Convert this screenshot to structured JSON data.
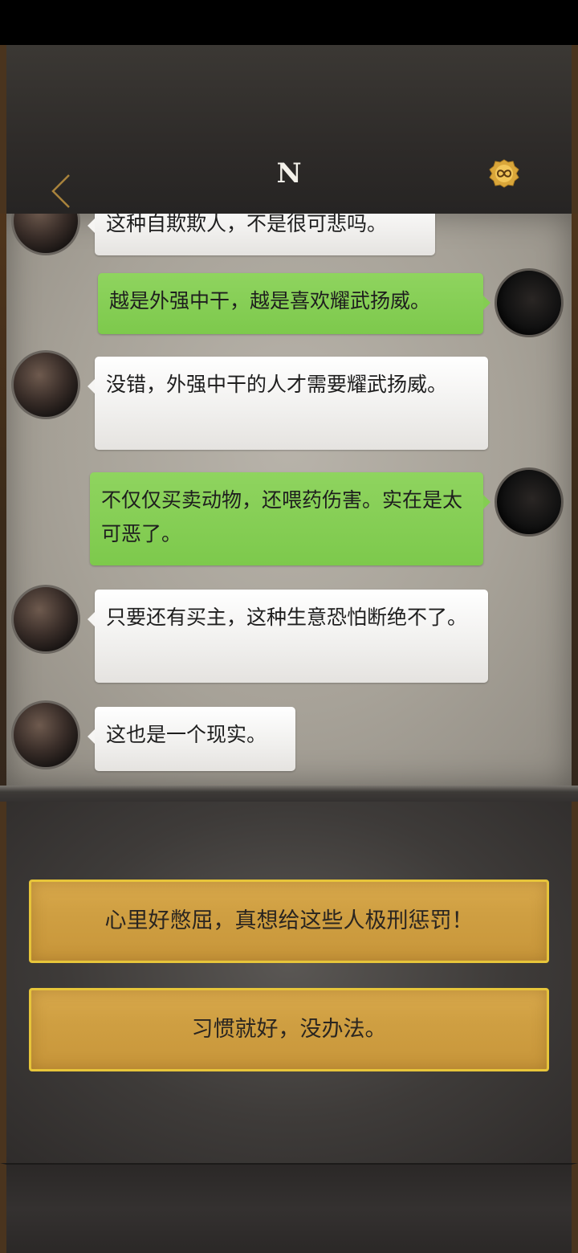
{
  "header": {
    "title": "N",
    "back_icon": "chevron-left-icon",
    "coin_icon": "infinity-coin-icon"
  },
  "messages": [
    {
      "side": "left",
      "text": "这种自欺欺人，不是很可悲吗。"
    },
    {
      "side": "right",
      "text": "越是外强中干，越是喜欢耀武扬威。"
    },
    {
      "side": "left",
      "text": "没错，外强中干的人才需要耀武扬威。"
    },
    {
      "side": "right",
      "text": "不仅仅买卖动物，还喂药伤害。实在是太可恶了。"
    },
    {
      "side": "left",
      "text": "只要还有买主，这种生意恐怕断绝不了。"
    },
    {
      "side": "left",
      "text": "这也是一个现实。"
    }
  ],
  "choices": [
    {
      "label": "心里好憋屈，真想给这些人极刑惩罚！"
    },
    {
      "label": "习惯就好，没办法。"
    }
  ],
  "colors": {
    "accent_gold": "#e7c53a",
    "bubble_green": "#84cd52"
  }
}
